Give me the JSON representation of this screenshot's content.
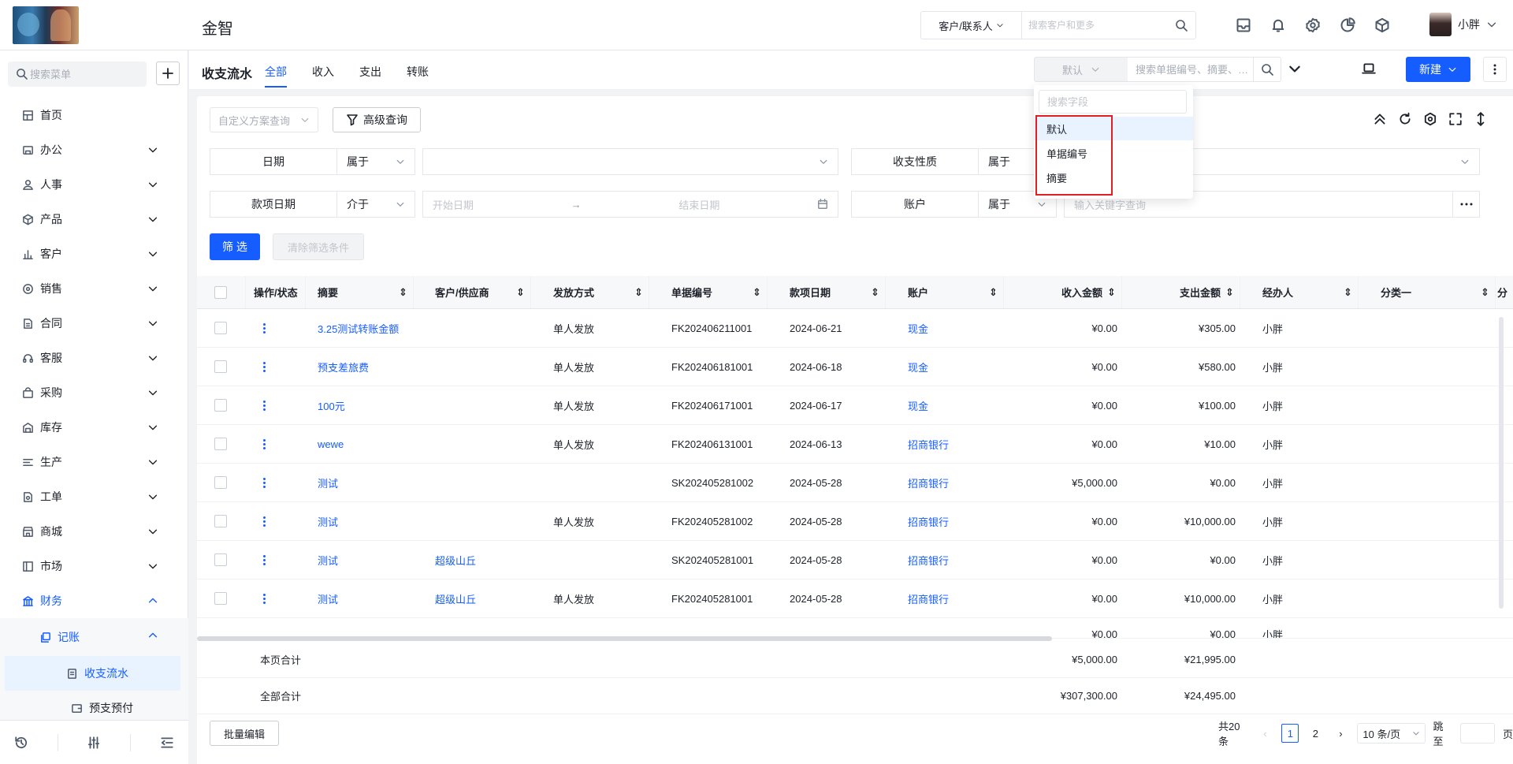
{
  "app": {
    "title": "金智"
  },
  "header": {
    "customer_select": "客户/联系人",
    "search_placeholder": "搜索客户和更多",
    "user_name": "小胖"
  },
  "sidebar": {
    "search_placeholder": "搜索菜单",
    "items": [
      {
        "label": "首页",
        "icon": "home-icon"
      },
      {
        "label": "办公",
        "icon": "office-icon"
      },
      {
        "label": "人事",
        "icon": "people-icon"
      },
      {
        "label": "产品",
        "icon": "cube-icon"
      },
      {
        "label": "客户",
        "icon": "chart-icon"
      },
      {
        "label": "销售",
        "icon": "sales-icon"
      },
      {
        "label": "合同",
        "icon": "contract-icon"
      },
      {
        "label": "客服",
        "icon": "headset-icon"
      },
      {
        "label": "采购",
        "icon": "bag-icon"
      },
      {
        "label": "库存",
        "icon": "warehouse-icon"
      },
      {
        "label": "生产",
        "icon": "production-icon"
      },
      {
        "label": "工单",
        "icon": "ticket-icon"
      },
      {
        "label": "商城",
        "icon": "store-icon"
      },
      {
        "label": "市场",
        "icon": "market-icon"
      },
      {
        "label": "财务",
        "icon": "finance-icon"
      }
    ],
    "finance_sub": {
      "label": "记账"
    },
    "finance_sub2": [
      {
        "label": "收支流水"
      },
      {
        "label": "预支预付"
      }
    ]
  },
  "page": {
    "title": "收支流水",
    "tabs": [
      "全部",
      "收入",
      "支出",
      "转账"
    ],
    "field_select": "默认",
    "doc_search_placeholder": "搜索单据编号、摘要、…",
    "new_label": "新建"
  },
  "filters": {
    "scheme_placeholder": "自定义方案查询",
    "advanced_label": "高级查询",
    "row1": {
      "label1": "日期",
      "op1": "属于",
      "label2": "收支性质",
      "op2": "属于"
    },
    "row2": {
      "label1": "款项日期",
      "op1": "介于",
      "start": "开始日期",
      "end": "结束日期",
      "label2": "账户",
      "op2": "属于",
      "keyword_placeholder": "输入关键字查询"
    },
    "filter_label": "筛 选",
    "clear_label": "清除筛选条件"
  },
  "table": {
    "columns": [
      "操作/状态",
      "摘要",
      "客户/供应商",
      "发放方式",
      "单据编号",
      "款项日期",
      "账户",
      "收入金额",
      "支出金额",
      "经办人",
      "分类一",
      "分"
    ],
    "rows": [
      {
        "summary": "3.25测试转账金额",
        "partner": "",
        "method": "单人发放",
        "doc": "FK202406211001",
        "date": "2024-06-21",
        "account": "现金",
        "income": "¥0.00",
        "expense": "¥305.00",
        "handler": "小胖"
      },
      {
        "summary": "预支差旅费",
        "partner": "",
        "method": "单人发放",
        "doc": "FK202406181001",
        "date": "2024-06-18",
        "account": "现金",
        "income": "¥0.00",
        "expense": "¥580.00",
        "handler": "小胖"
      },
      {
        "summary": "100元",
        "partner": "",
        "method": "单人发放",
        "doc": "FK202406171001",
        "date": "2024-06-17",
        "account": "现金",
        "income": "¥0.00",
        "expense": "¥100.00",
        "handler": "小胖"
      },
      {
        "summary": "wewe",
        "partner": "",
        "method": "单人发放",
        "doc": "FK202406131001",
        "date": "2024-06-13",
        "account": "招商银行",
        "income": "¥0.00",
        "expense": "¥10.00",
        "handler": "小胖"
      },
      {
        "summary": "测试",
        "partner": "",
        "method": "",
        "doc": "SK202405281002",
        "date": "2024-05-28",
        "account": "招商银行",
        "income": "¥5,000.00",
        "expense": "¥0.00",
        "handler": "小胖"
      },
      {
        "summary": "测试",
        "partner": "",
        "method": "单人发放",
        "doc": "FK202405281002",
        "date": "2024-05-28",
        "account": "招商银行",
        "income": "¥0.00",
        "expense": "¥10,000.00",
        "handler": "小胖"
      },
      {
        "summary": "测试",
        "partner": "超级山丘",
        "method": "",
        "doc": "SK202405281001",
        "date": "2024-05-28",
        "account": "招商银行",
        "income": "¥0.00",
        "expense": "¥0.00",
        "handler": "小胖"
      },
      {
        "summary": "测试",
        "partner": "超级山丘",
        "method": "单人发放",
        "doc": "FK202405281001",
        "date": "2024-05-28",
        "account": "招商银行",
        "income": "¥0.00",
        "expense": "¥10,000.00",
        "handler": "小胖"
      }
    ],
    "partial_row": {
      "income": "¥0.00",
      "expense": "¥0.00",
      "handler": "小胖"
    }
  },
  "totals": {
    "page_label": "本页合计",
    "page_income": "¥5,000.00",
    "page_expense": "¥21,995.00",
    "all_label": "全部合计",
    "all_income": "¥307,300.00",
    "all_expense": "¥24,495.00"
  },
  "footer": {
    "bulk_label": "批量编辑",
    "total": "共20条",
    "pages": [
      "1",
      "2"
    ],
    "page_size": "10 条/页",
    "jump_label": "跳至",
    "page_unit": "页"
  },
  "dropdown": {
    "search_placeholder": "搜索字段",
    "options": [
      "默认",
      "单据编号",
      "摘要"
    ]
  },
  "colors": {
    "accent": "#165dff",
    "highlight": "#e02020"
  }
}
